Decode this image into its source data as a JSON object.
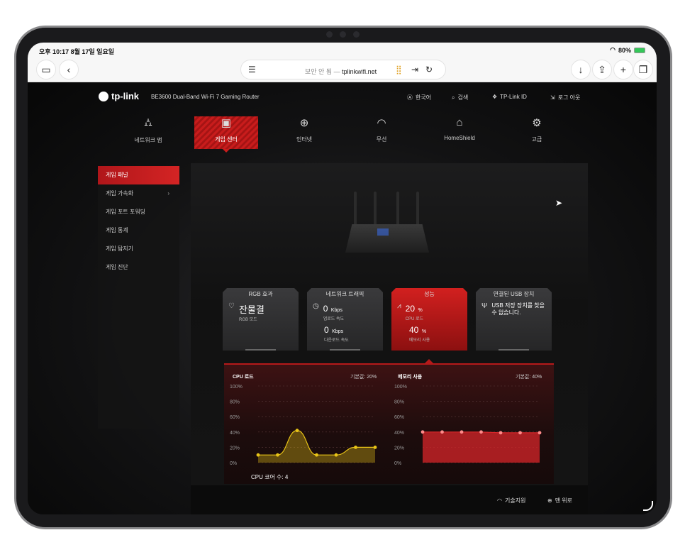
{
  "status": {
    "time": "오후 10:17",
    "date": "8월 17일 일요일",
    "battery": "80%"
  },
  "browser": {
    "url_prefix": "보안 안 됨 — ",
    "url_host": "tplinkwifi.net"
  },
  "header": {
    "logo": "tp-link",
    "product": "BE3600 Dual-Band Wi-Fi 7 Gaming Router",
    "language": "한국어",
    "search": "검색",
    "tplink_id": "TP-Link ID",
    "logout": "로그 아웃"
  },
  "nav": {
    "items": [
      {
        "label": "네트워크 맵",
        "icon": "network-map-icon"
      },
      {
        "label": "게임 센터",
        "icon": "gamepad-icon"
      },
      {
        "label": "인터넷",
        "icon": "globe-icon"
      },
      {
        "label": "무선",
        "icon": "wifi-icon"
      },
      {
        "label": "HomeShield",
        "icon": "shield-home-icon"
      },
      {
        "label": "고급",
        "icon": "gear-icon"
      }
    ],
    "active": "게임 센터"
  },
  "sidebar": {
    "items": [
      {
        "label": "게임 패널"
      },
      {
        "label": "게임 가속화"
      },
      {
        "label": "게임 포트 포워딩"
      },
      {
        "label": "게임 통계"
      },
      {
        "label": "게임 탐지기"
      },
      {
        "label": "게임 진단"
      }
    ],
    "active": "게임 패널"
  },
  "cards": {
    "rgb": {
      "title": "RGB 효과",
      "value": "잔물결",
      "sub": "RGB 모드"
    },
    "traffic": {
      "title": "네트워크 트래픽",
      "upload_value": "0",
      "upload_unit": "Kbps",
      "upload_label": "업로드 속도",
      "download_value": "0",
      "download_unit": "Kbps",
      "download_label": "다운로드 속도"
    },
    "performance": {
      "title": "성능",
      "cpu_value": "20",
      "cpu_unit": "%",
      "cpu_label": "CPU 로드",
      "mem_value": "40",
      "mem_unit": "%",
      "mem_label": "메모리 사용"
    },
    "usb": {
      "title": "연결된 USB 장치",
      "text": "USB 저장 장치를 찾을 수 없습니다."
    }
  },
  "charts": {
    "cpu_title": "CPU 로드",
    "cpu_base": "기본값: 20%",
    "mem_title": "메모리 사용",
    "mem_base": "기본값: 40%",
    "cores": "CPU 코어 수: 4",
    "yticks": [
      "100%",
      "80%",
      "60%",
      "40%",
      "20%",
      "0%"
    ]
  },
  "chart_data": [
    {
      "type": "area",
      "title": "CPU 로드",
      "ylim": [
        0,
        100
      ],
      "x": [
        1,
        2,
        3,
        4,
        5,
        6,
        7
      ],
      "series": [
        {
          "values": [
            10,
            10,
            42,
            10,
            10,
            20,
            20
          ]
        }
      ],
      "color": "#e8c417"
    },
    {
      "type": "area",
      "title": "메모리 사용",
      "ylim": [
        0,
        100
      ],
      "x": [
        1,
        2,
        3,
        4,
        5,
        6,
        7
      ],
      "series": [
        {
          "values": [
            40,
            40,
            40,
            40,
            39,
            39,
            39
          ]
        }
      ],
      "color": "#d8262a"
    }
  ],
  "footer": {
    "support": "기술지원",
    "top": "맨 위로"
  },
  "colors": {
    "accent": "#c81c1c",
    "cpu_line": "#e8c417",
    "mem_line": "#d8262a"
  }
}
